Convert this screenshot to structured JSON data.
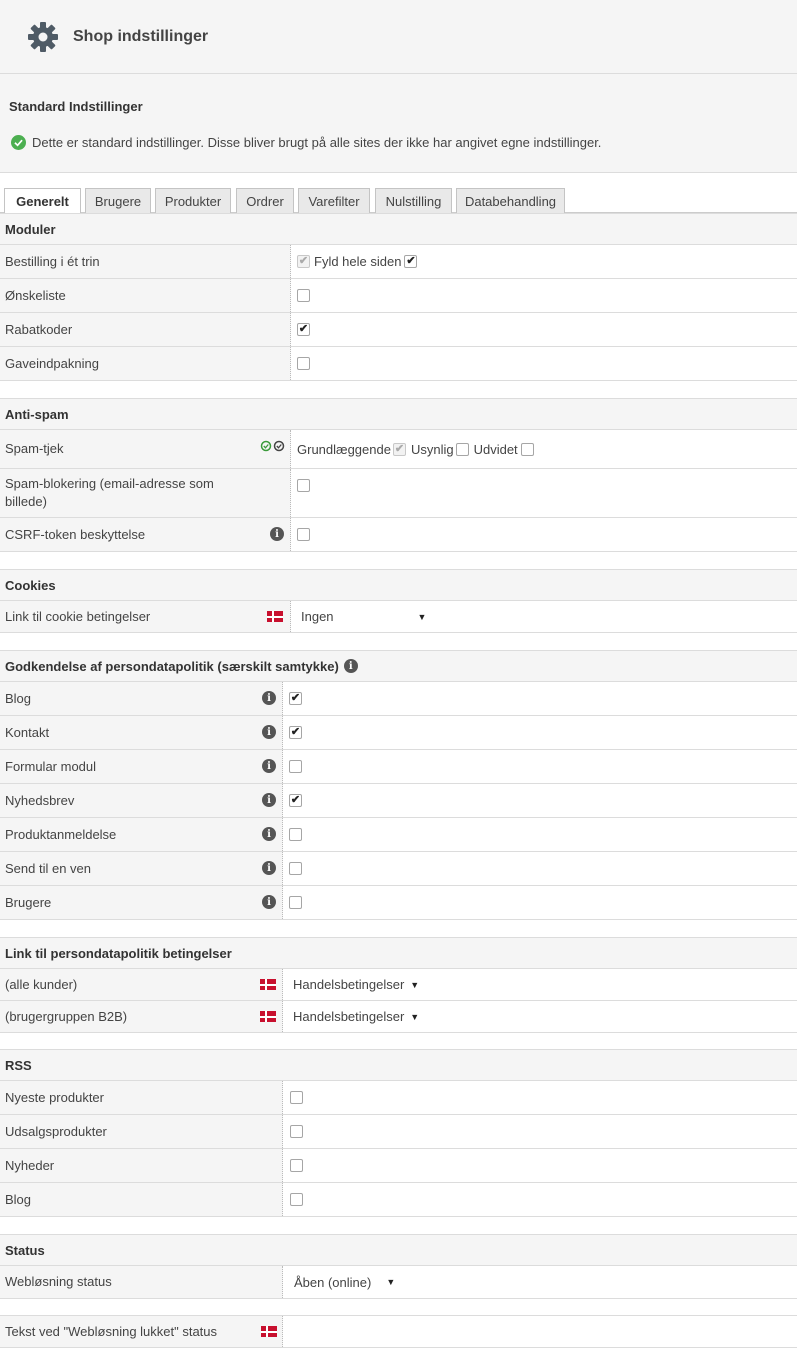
{
  "header": {
    "title": "Shop indstillinger"
  },
  "info": {
    "title": "Standard Indstillinger",
    "message": "Dette er standard indstillinger. Disse bliver brugt på alle sites der ikke har angivet egne indstillinger."
  },
  "tabs": [
    "Generelt",
    "Brugere",
    "Produkter",
    "Ordrer",
    "Varefilter",
    "Nulstilling",
    "Databehandling"
  ],
  "moduler": {
    "title": "Moduler",
    "bestilling": {
      "label": "Bestilling i ét trin",
      "extra_label": "Fyld hele siden"
    },
    "onskeliste": {
      "label": "Ønskeliste"
    },
    "rabatkoder": {
      "label": "Rabatkoder"
    },
    "gaveindpakning": {
      "label": "Gaveindpakning"
    }
  },
  "antispam": {
    "title": "Anti-spam",
    "spamtjek": {
      "label": "Spam-tjek",
      "options": [
        "Grundlæggende",
        "Usynlig",
        "Udvidet"
      ]
    },
    "spamblok": {
      "label": "Spam-blokering (email-adresse som billede)"
    },
    "csrf": {
      "label": "CSRF-token beskyttelse"
    }
  },
  "cookies": {
    "title": "Cookies",
    "link": {
      "label": "Link til cookie betingelser",
      "value": "Ingen"
    }
  },
  "godkendelse": {
    "title": "Godkendelse af persondatapolitik (særskilt samtykke)",
    "items": [
      {
        "label": "Blog",
        "checked": true
      },
      {
        "label": "Kontakt",
        "checked": true
      },
      {
        "label": "Formular modul",
        "checked": false
      },
      {
        "label": "Nyhedsbrev",
        "checked": true
      },
      {
        "label": "Produktanmeldelse",
        "checked": false
      },
      {
        "label": "Send til en ven",
        "checked": false
      },
      {
        "label": "Brugere",
        "checked": false
      }
    ]
  },
  "linkpolitik": {
    "title": "Link til persondatapolitik betingelser",
    "rows": [
      {
        "label": "(alle kunder)",
        "value": "Handelsbetingelser"
      },
      {
        "label": "(brugergruppen B2B)",
        "value": "Handelsbetingelser"
      }
    ]
  },
  "rss": {
    "title": "RSS",
    "items": [
      {
        "label": "Nyeste produkter"
      },
      {
        "label": "Udsalgsprodukter"
      },
      {
        "label": "Nyheder"
      },
      {
        "label": "Blog"
      }
    ]
  },
  "status": {
    "title": "Status",
    "weblosning": {
      "label": "Webløsning status",
      "value": "Åben (online)"
    },
    "tekst": {
      "label": "Tekst ved \"Webløsning lukket\" status"
    }
  },
  "colors": {
    "accent_green": "#4caf50",
    "flag_red": "#c8102e",
    "header_bg": "#f5f5f5"
  }
}
